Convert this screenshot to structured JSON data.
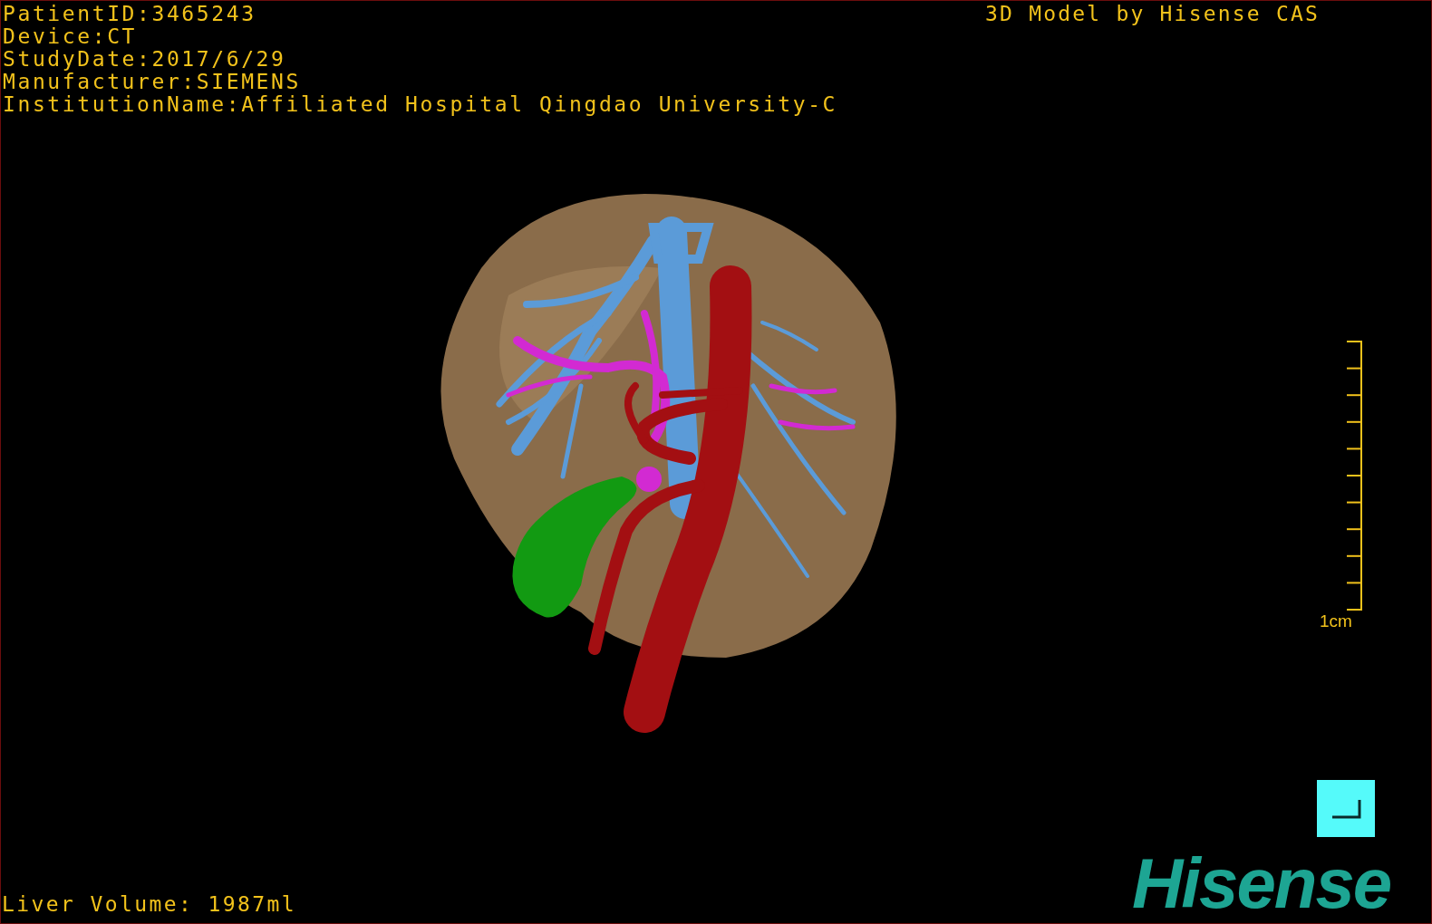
{
  "viewer": {
    "info_lines": [
      "PatientID:3465243",
      "Device:CT",
      "StudyDate:2017/6/29",
      "Manufacturer:SIEMENS",
      "InstitutionName:Affiliated Hospital Qingdao University-C"
    ],
    "credit": "3D Model by Hisense CAS",
    "scale_label": "1cm",
    "liver_volume": "Liver Volume: 1987ml",
    "logo": "Hisense"
  }
}
